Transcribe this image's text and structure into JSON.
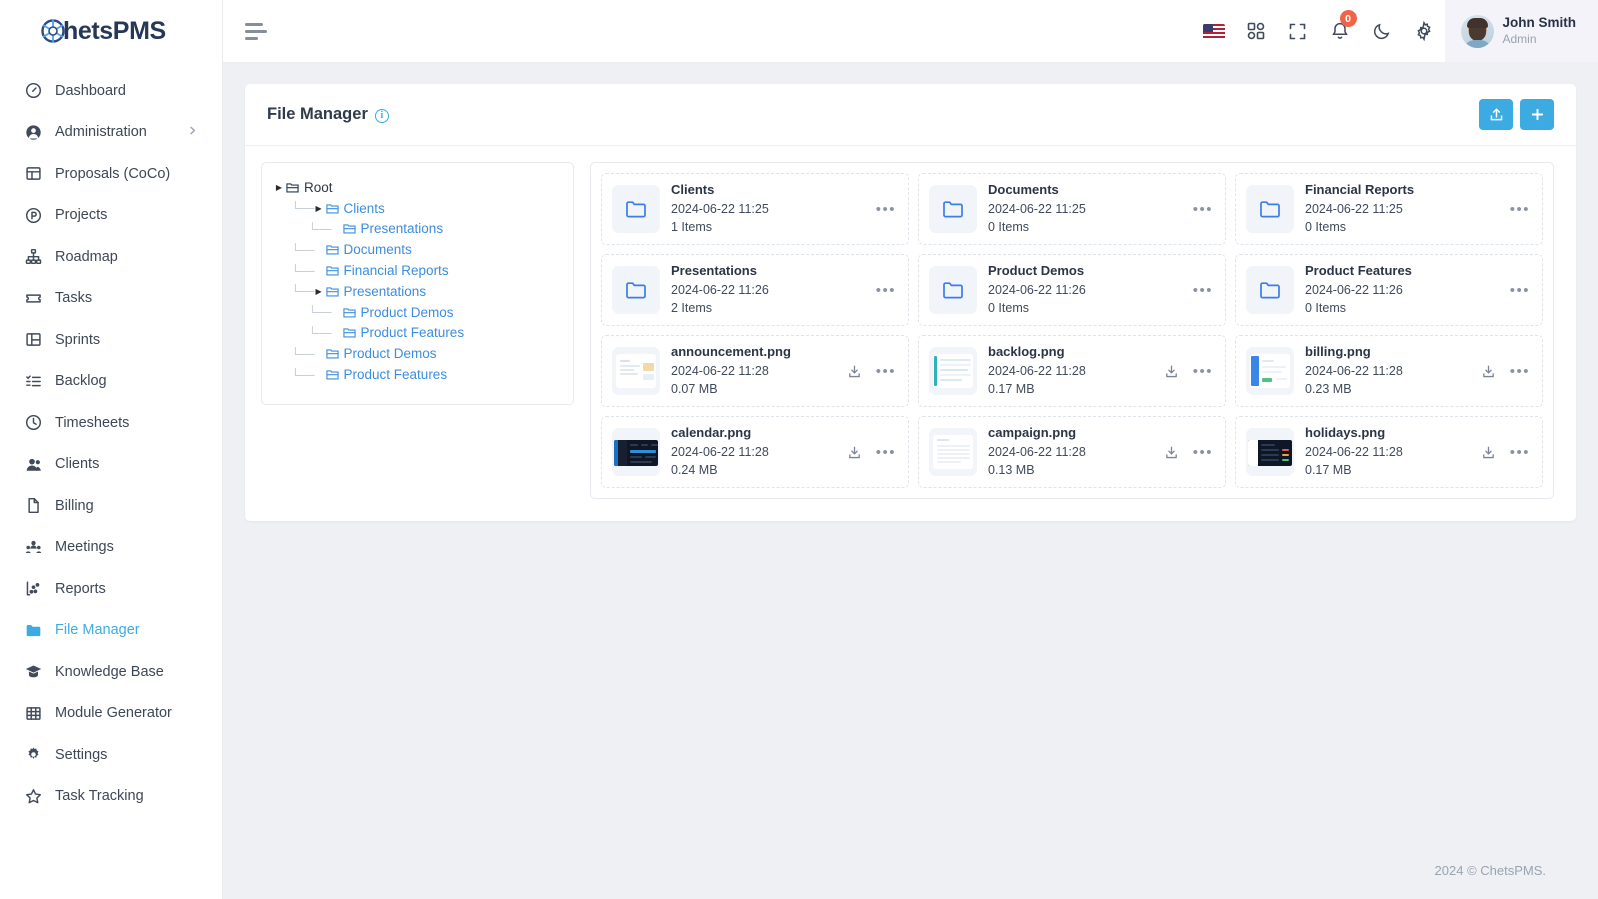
{
  "brand": {
    "logo_text": "hetsPMS",
    "accent": "#3cabe2",
    "navy": "#253858"
  },
  "sidebar": {
    "items": [
      {
        "label": "Dashboard",
        "icon": "gauge-icon",
        "active": false,
        "expandable": false
      },
      {
        "label": "Administration",
        "icon": "user-circle-icon",
        "active": false,
        "expandable": true
      },
      {
        "label": "Proposals (CoCo)",
        "icon": "proposal-icon",
        "active": false,
        "expandable": false
      },
      {
        "label": "Projects",
        "icon": "project-circle-icon",
        "active": false,
        "expandable": false
      },
      {
        "label": "Roadmap",
        "icon": "sitemap-icon",
        "active": false,
        "expandable": false
      },
      {
        "label": "Tasks",
        "icon": "ticket-icon",
        "active": false,
        "expandable": false
      },
      {
        "label": "Sprints",
        "icon": "board-icon",
        "active": false,
        "expandable": false
      },
      {
        "label": "Backlog",
        "icon": "list-check-icon",
        "active": false,
        "expandable": false
      },
      {
        "label": "Timesheets",
        "icon": "clock-icon",
        "active": false,
        "expandable": false
      },
      {
        "label": "Clients",
        "icon": "user-group-icon",
        "active": false,
        "expandable": false
      },
      {
        "label": "Billing",
        "icon": "file-icon",
        "active": false,
        "expandable": false
      },
      {
        "label": "Meetings",
        "icon": "people-icon",
        "active": false,
        "expandable": false
      },
      {
        "label": "Reports",
        "icon": "chart-icon",
        "active": false,
        "expandable": false
      },
      {
        "label": "File Manager",
        "icon": "folder-icon",
        "active": true,
        "expandable": false
      },
      {
        "label": "Knowledge Base",
        "icon": "graduation-cap-icon",
        "active": false,
        "expandable": false
      },
      {
        "label": "Module Generator",
        "icon": "grid-table-icon",
        "active": false,
        "expandable": false
      },
      {
        "label": "Settings",
        "icon": "gear-icon",
        "active": false,
        "expandable": false
      },
      {
        "label": "Task Tracking",
        "icon": "star-icon",
        "active": false,
        "expandable": false
      }
    ]
  },
  "topbar": {
    "menu_toggle": "hamburger-icon",
    "icons": [
      {
        "name": "flag-us-icon"
      },
      {
        "name": "apps-grid-icon"
      },
      {
        "name": "fullscreen-icon"
      },
      {
        "name": "bell-icon",
        "badge": "0"
      },
      {
        "name": "moon-icon"
      },
      {
        "name": "gear-icon"
      }
    ],
    "user": {
      "name": "John Smith",
      "role": "Admin"
    }
  },
  "page": {
    "title": "File Manager",
    "info_icon": "info-icon",
    "actions": [
      {
        "name": "upload-button",
        "icon": "upload-icon"
      },
      {
        "name": "add-button",
        "icon": "plus-icon"
      }
    ]
  },
  "tree": {
    "nodes": [
      {
        "label": "Root",
        "depth": 0,
        "caret": true,
        "root": true
      },
      {
        "label": "Clients",
        "depth": 1,
        "caret": true,
        "root": false
      },
      {
        "label": "Presentations",
        "depth": 2,
        "caret": false,
        "root": false
      },
      {
        "label": "Documents",
        "depth": 1,
        "caret": false,
        "root": false
      },
      {
        "label": "Financial Reports",
        "depth": 1,
        "caret": false,
        "root": false
      },
      {
        "label": "Presentations",
        "depth": 1,
        "caret": true,
        "root": false
      },
      {
        "label": "Product Demos",
        "depth": 2,
        "caret": false,
        "root": false
      },
      {
        "label": "Product Features",
        "depth": 2,
        "caret": false,
        "root": false
      },
      {
        "label": "Product Demos",
        "depth": 1,
        "caret": false,
        "root": false
      },
      {
        "label": "Product Features",
        "depth": 1,
        "caret": false,
        "root": false
      }
    ]
  },
  "files": [
    {
      "name": "Clients",
      "date": "2024-06-22 11:25",
      "sub": "1 Items",
      "type": "folder",
      "thumb": "folder-icon",
      "download": false
    },
    {
      "name": "Documents",
      "date": "2024-06-22 11:25",
      "sub": "0 Items",
      "type": "folder",
      "thumb": "folder-icon",
      "download": false
    },
    {
      "name": "Financial Reports",
      "date": "2024-06-22 11:25",
      "sub": "0 Items",
      "type": "folder",
      "thumb": "folder-icon",
      "download": false
    },
    {
      "name": "Presentations",
      "date": "2024-06-22 11:26",
      "sub": "2 Items",
      "type": "folder",
      "thumb": "folder-icon",
      "download": false
    },
    {
      "name": "Product Demos",
      "date": "2024-06-22 11:26",
      "sub": "0 Items",
      "type": "folder",
      "thumb": "folder-icon",
      "download": false
    },
    {
      "name": "Product Features",
      "date": "2024-06-22 11:26",
      "sub": "0 Items",
      "type": "folder",
      "thumb": "folder-icon",
      "download": false
    },
    {
      "name": "announcement.png",
      "date": "2024-06-22 11:28",
      "sub": "0.07 MB",
      "type": "image",
      "thumb": "light-doc-preview",
      "download": true
    },
    {
      "name": "backlog.png",
      "date": "2024-06-22 11:28",
      "sub": "0.17 MB",
      "type": "image",
      "thumb": "teal-list-preview",
      "download": true
    },
    {
      "name": "billing.png",
      "date": "2024-06-22 11:28",
      "sub": "0.23 MB",
      "type": "image",
      "thumb": "blue-panel-preview",
      "download": true
    },
    {
      "name": "calendar.png",
      "date": "2024-06-22 11:28",
      "sub": "0.24 MB",
      "type": "image",
      "thumb": "dark-app-preview",
      "download": true
    },
    {
      "name": "campaign.png",
      "date": "2024-06-22 11:28",
      "sub": "0.13 MB",
      "type": "image",
      "thumb": "light-grid-preview",
      "download": true
    },
    {
      "name": "holidays.png",
      "date": "2024-06-22 11:28",
      "sub": "0.17 MB",
      "type": "image",
      "thumb": "dark-table-preview",
      "download": true
    }
  ],
  "footer": {
    "text": "2024 © ChetsPMS."
  }
}
